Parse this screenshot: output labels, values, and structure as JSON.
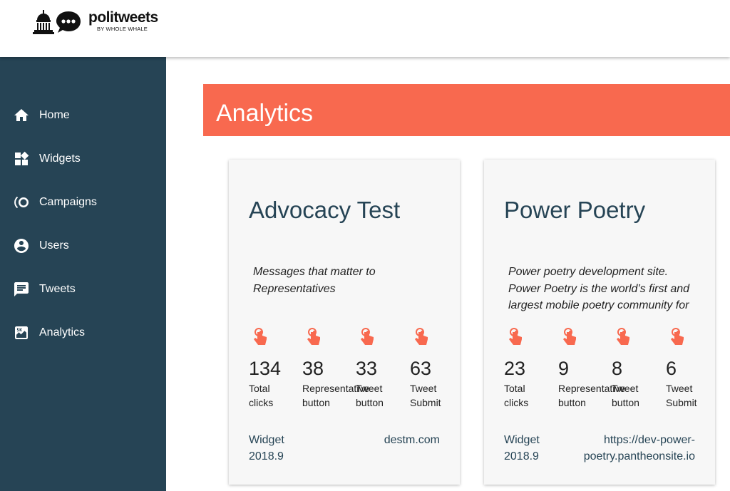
{
  "app": {
    "logo_title": "politweets",
    "logo_subtitle": "BY WHOLE WHALE"
  },
  "sidebar": {
    "items": [
      {
        "label": "Home",
        "icon": "home-icon"
      },
      {
        "label": "Widgets",
        "icon": "widgets-icon"
      },
      {
        "label": "Campaigns",
        "icon": "campaigns-icon"
      },
      {
        "label": "Users",
        "icon": "users-icon"
      },
      {
        "label": "Tweets",
        "icon": "tweets-icon"
      },
      {
        "label": "Analytics",
        "icon": "analytics-icon"
      }
    ]
  },
  "page": {
    "title": "Analytics"
  },
  "cards": [
    {
      "title": "Advocacy Test",
      "description": "Messages that matter to Representatives",
      "stats": [
        {
          "value": "134",
          "label": "Total\nclicks"
        },
        {
          "value": "38",
          "label": "Representative\nbutton"
        },
        {
          "value": "33",
          "label": "Tweet\nbutton"
        },
        {
          "value": "63",
          "label": "Tweet\nSubmit"
        }
      ],
      "widget_label": "Widget\n2018.9",
      "site": "destm.com"
    },
    {
      "title": "Power Poetry",
      "description": "Power poetry development site. Power Poetry is the world’s first and largest mobile poetry community for",
      "stats": [
        {
          "value": "23",
          "label": "Total\nclicks"
        },
        {
          "value": "9",
          "label": "Representative\nbutton"
        },
        {
          "value": "8",
          "label": "Tweet\nbutton"
        },
        {
          "value": "6",
          "label": "Tweet\nSubmit"
        }
      ],
      "widget_label": "Widget\n2018.9",
      "site": "https://dev-power-\npoetry.pantheonsite.io"
    }
  ],
  "colors": {
    "sidebar": "#264455",
    "accent": "#f8694f",
    "card_bg": "#f7f7f7",
    "heading": "#264455"
  }
}
